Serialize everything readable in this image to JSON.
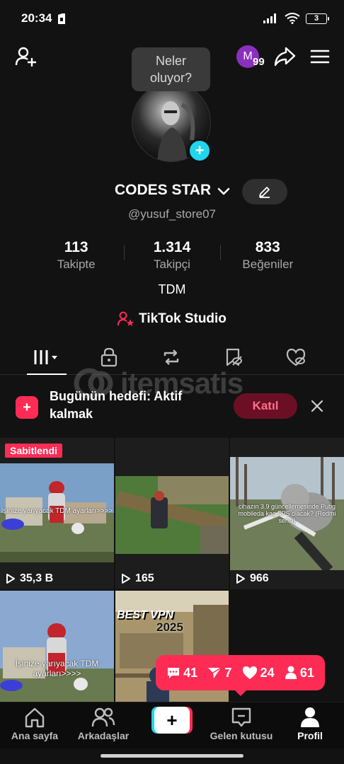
{
  "status_bar": {
    "time": "20:34",
    "battery": "3"
  },
  "header": {
    "notification_initial": "M",
    "notification_count": "99",
    "tooltip_line1": "Neler",
    "tooltip_line2": "oluyor?"
  },
  "profile": {
    "display_name": "CODES STAR",
    "username": "@yusuf_store07",
    "bio": "TDM",
    "studio_label": "TikTok Studio"
  },
  "stats": [
    {
      "value": "113",
      "label": "Takipte"
    },
    {
      "value": "1.314",
      "label": "Takipçi"
    },
    {
      "value": "833",
      "label": "Beğeniler"
    }
  ],
  "watermark": "itemsatis",
  "goal": {
    "text": "Bugünün hedefi: Aktif kalmak",
    "button": "Katıl"
  },
  "videos": [
    {
      "pinned_label": "Sabitlendi",
      "views": "35,3 B",
      "caption": "İşinize yarıyacak TDM ayarları>>>>"
    },
    {
      "views": "165"
    },
    {
      "views": "966",
      "caption": "cihazın 3.9 güncellemesinde Pubg mobileda kaç FPS olacak? (Redmi serisi)"
    },
    {
      "caption": "İşinize yarıyacak TDM ayarları>>>>"
    },
    {
      "caption_title": "BEST VPN",
      "caption_year": "2025"
    }
  ],
  "activity": {
    "comments": "41",
    "shares": "7",
    "likes": "24",
    "followers": "61"
  },
  "nav": {
    "home": "Ana sayfa",
    "friends": "Arkadaşlar",
    "create": "+",
    "inbox": "Gelen kutusu",
    "profile": "Profil"
  }
}
